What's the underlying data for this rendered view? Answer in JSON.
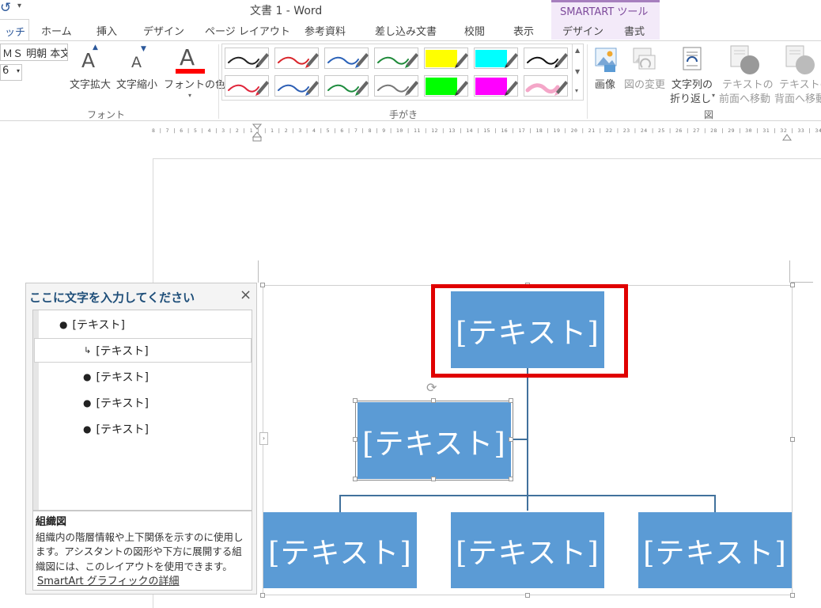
{
  "titlebar": {
    "title": "文書 1 - Word",
    "context_group": "SMARTART ツール"
  },
  "tabs": [
    "ッチ",
    "ホーム",
    "挿入",
    "デザイン",
    "ページ レイアウト",
    "参考資料",
    "差し込み文書",
    "校閲",
    "表示",
    "デザイン",
    "書式"
  ],
  "ribbon": {
    "font_name": "ＭＳ 明朝 本文",
    "font_size": "6",
    "grow_font": "文字拡大",
    "shrink_font": "文字縮小",
    "font_color": "フォントの色",
    "font_group": "フォント",
    "pen_group": "手がき",
    "picture": "画像",
    "change_picture": "図の変更",
    "wrap_line1": "文字列の",
    "wrap_line2": "折り返し",
    "bring_front_line1": "テキストの",
    "bring_front_line2": "前面へ移動",
    "send_back_line1": "テキストの",
    "send_back_line2": "背面へ移動",
    "picture_group": "図",
    "pen_colors_row1": [
      "#222222",
      "#d9262c",
      "#2b62b8",
      "#1f8a3a",
      "#ffff00",
      "#00ffff",
      "#111111"
    ],
    "pen_colors_row2": [
      "#e0253a",
      "#2d5fb5",
      "#1e8c3e",
      "#777777",
      "#00ff00",
      "#ff00ff",
      "#f4a6c8"
    ]
  },
  "ruler": {
    "text": "8 | 7 | 6 | 5 | 4 | 3 | 2 | 1 |    | 1 | 2 | 3 | 4 | 5 | 6 | 7 | 8 | 9 | 10 | 11 | 12 | 13 | 14 | 15 | 16 | 17 | 18 | 19 | 20 | 21 | 22 | 23 | 24 | 25 | 26 | 27 | 28 | 29 | 30 | 31 | 32 | 33 | 34 | 35 | 36 | 37 | 38 | 39 | 40 | 41 | 42"
  },
  "text_pane": {
    "title": "ここに文字を入力してください",
    "close": "×",
    "items": [
      "[テキスト]",
      "[テキスト]",
      "[テキスト]",
      "[テキスト]",
      "[テキスト]"
    ],
    "desc_title": "組織図",
    "desc_body": "組織内の階層情報や上下関係を示すのに使用します。アシスタントの図形や下方に展開する組織図には、このレイアウトを使用できます。",
    "link": "SmartArt グラフィックの詳細"
  },
  "smartart": {
    "node_text": "[テキスト]",
    "node_color": "#5b9bd5",
    "connector_color": "#41719c",
    "highlight_color": "#e00000"
  }
}
